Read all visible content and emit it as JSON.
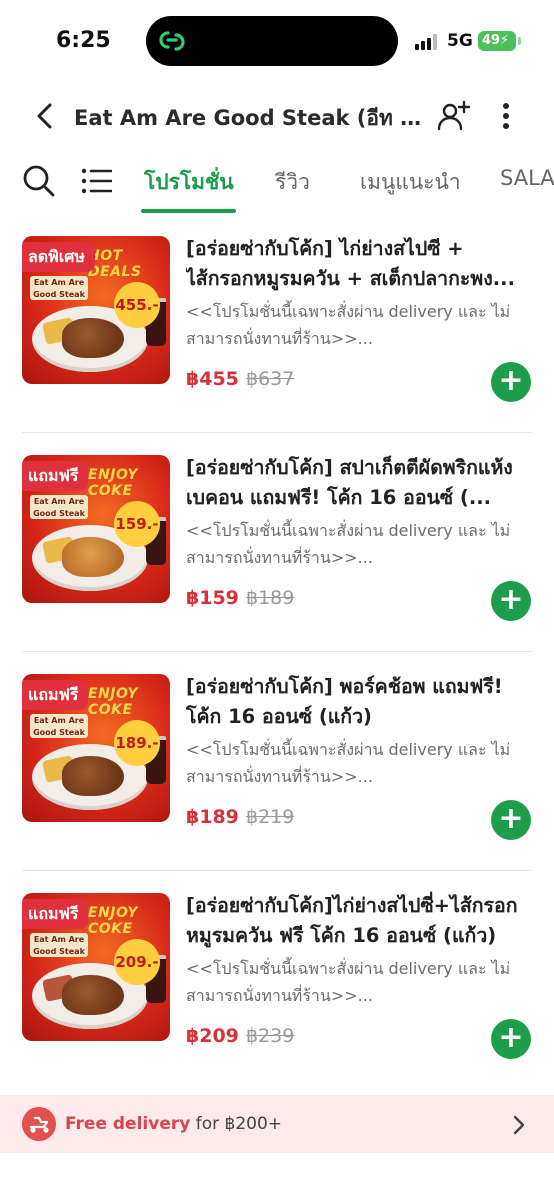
{
  "status_bar": {
    "time": "6:25",
    "network": "5G",
    "battery": "49"
  },
  "header": {
    "title": "Eat Am Are Good Steak (อีท แอ..."
  },
  "tabs": [
    {
      "label": "โปรโมชั่น",
      "active": true
    },
    {
      "label": "รีวิว",
      "active": false
    },
    {
      "label": "เมนูแนะนำ",
      "active": false
    },
    {
      "label": "SALA",
      "active": false
    }
  ],
  "items": [
    {
      "badge": "ลดพิเศษ",
      "thumb_headline": "HOT DEALS",
      "thumb_brand": "Eat Am Are Good Steak",
      "thumb_price": "455.-",
      "title": "[อร่อยซ่ากับโค้ก] ไก่ย่างสไปซี + ไส้กรอกหมูรมควัน + สเต็กปลากะพง...",
      "description": "<<โปรโมชั่นนี้เฉพาะสั่งผ่าน delivery และ ไม่สามารถนั่งทานที่ร้าน>>...",
      "price": "฿455",
      "original_price": "฿637"
    },
    {
      "badge": "แถมฟรี",
      "thumb_headline": "ENJOY COKE",
      "thumb_brand": "Eat Am Are Good Steak",
      "thumb_price": "159.-",
      "title": "[อร่อยซ่ากับโค้ก] สปาเก็ตตีผัดพริกแห้งเบคอน แถมฟรี! โค้ก 16 ออนซ์ (...",
      "description": "<<โปรโมชั่นนี้เฉพาะสั่งผ่าน delivery และ ไม่สามารถนั่งทานที่ร้าน>>...",
      "price": "฿159",
      "original_price": "฿189"
    },
    {
      "badge": "แถมฟรี",
      "thumb_headline": "ENJOY COKE",
      "thumb_brand": "Eat Am Are Good Steak",
      "thumb_price": "189.-",
      "title": "[อร่อยซ่ากับโค้ก] พอร์คช้อพ แถมฟรี! โค้ก 16 ออนซ์ (แก้ว)",
      "description": "<<โปรโมชั่นนี้เฉพาะสั่งผ่าน delivery และ ไม่สามารถนั่งทานที่ร้าน>>...",
      "price": "฿189",
      "original_price": "฿219"
    },
    {
      "badge": "แถมฟรี",
      "thumb_headline": "ENJOY COKE",
      "thumb_brand": "Eat Am Are Good Steak",
      "thumb_price": "209.-",
      "title": "[อร่อยซ่ากับโค้ก]ไก่ย่างสไปซี่+ไส้กรอกหมูรมควัน ฟรี โค้ก 16 ออนซ์ (แก้ว)",
      "description": "<<โปรโมชั่นนี้เฉพาะสั่งผ่าน delivery และ ไม่สามารถนั่งทานที่ร้าน>>...",
      "price": "฿209",
      "original_price": "฿239"
    }
  ],
  "footer": {
    "highlight": "Free delivery",
    "rest": "for ฿200+"
  },
  "colors": {
    "accent_green": "#1a9c48",
    "price_red": "#d9303a",
    "badge_red": "#e0303d",
    "banner_bg": "#fdeaea"
  },
  "icons": [
    "back-icon",
    "add-user-icon",
    "more-icon",
    "search-icon",
    "list-icon",
    "plus-icon",
    "delivery-icon",
    "chevron-right-icon"
  ]
}
